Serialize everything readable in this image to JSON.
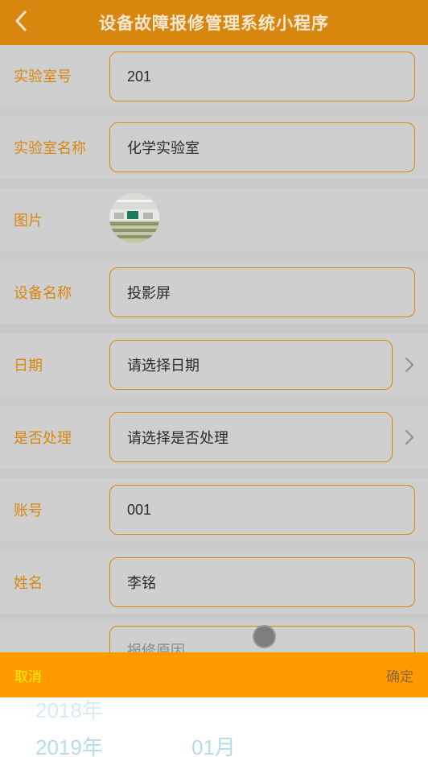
{
  "header": {
    "back_icon": "chevron-left-icon",
    "title": "设备故障报修管理系统小程序"
  },
  "form": {
    "lab_no": {
      "label": "实验室号",
      "value": "201"
    },
    "lab_name": {
      "label": "实验室名称",
      "value": "化学实验室"
    },
    "image": {
      "label": "图片",
      "icon": "lab-thumbnail-image"
    },
    "device_name": {
      "label": "设备名称",
      "value": "投影屏"
    },
    "date": {
      "label": "日期",
      "placeholder": "请选择日期"
    },
    "handled": {
      "label": "是否处理",
      "placeholder": "请选择是否处理"
    },
    "account": {
      "label": "账号",
      "value": "001"
    },
    "name": {
      "label": "姓名",
      "value": "李铭"
    },
    "reason": {
      "placeholder": "报修原因"
    }
  },
  "picker": {
    "cancel_label": "取消",
    "confirm_label": "确定",
    "year_prev": "2018年",
    "year_selected": "2019年",
    "month_selected": "01月"
  },
  "colors": {
    "accent": "#d8870e",
    "picker_bar": "#ff9a00",
    "cancel_text": "#fff200"
  }
}
